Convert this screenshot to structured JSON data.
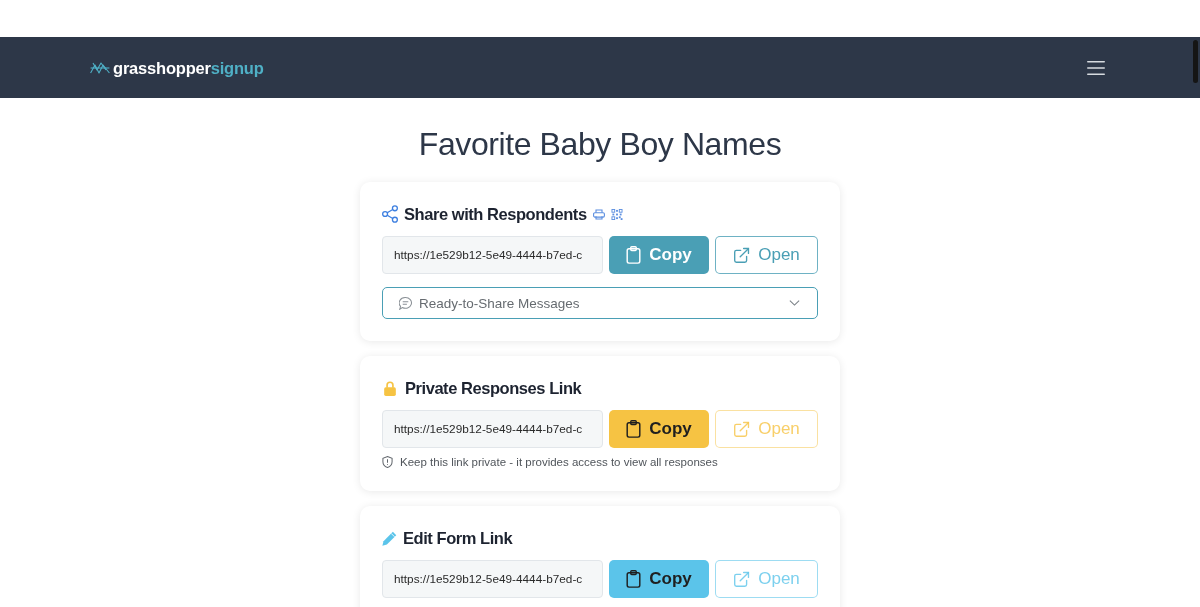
{
  "header": {
    "logo": {
      "text_part_1": "grasshopper",
      "text_part_2": "signup"
    }
  },
  "title": "Favorite Baby Boy Names",
  "cards": [
    {
      "kind": "share",
      "title": "Share with Respondents",
      "color": "#4a9fb5",
      "url": "https://1e529b12-5e49-4444-b7ed-c",
      "copy_label": "Copy",
      "open_label": "Open",
      "messages_dropdown": {
        "label": "Ready-to-Share Messages",
        "expanded": false
      }
    },
    {
      "kind": "private",
      "title": "Private Responses Link",
      "color": "#f6c343",
      "url": "https://1e529b12-5e49-4444-b7ed-c",
      "copy_label": "Copy",
      "open_label": "Open",
      "note": "Keep this link private - it provides access to view all responses"
    },
    {
      "kind": "edit",
      "title": "Edit Form Link",
      "color": "#5bc4ea",
      "url": "https://1e529b12-5e49-4444-b7ed-c",
      "copy_label": "Copy",
      "open_label": "Open"
    }
  ]
}
